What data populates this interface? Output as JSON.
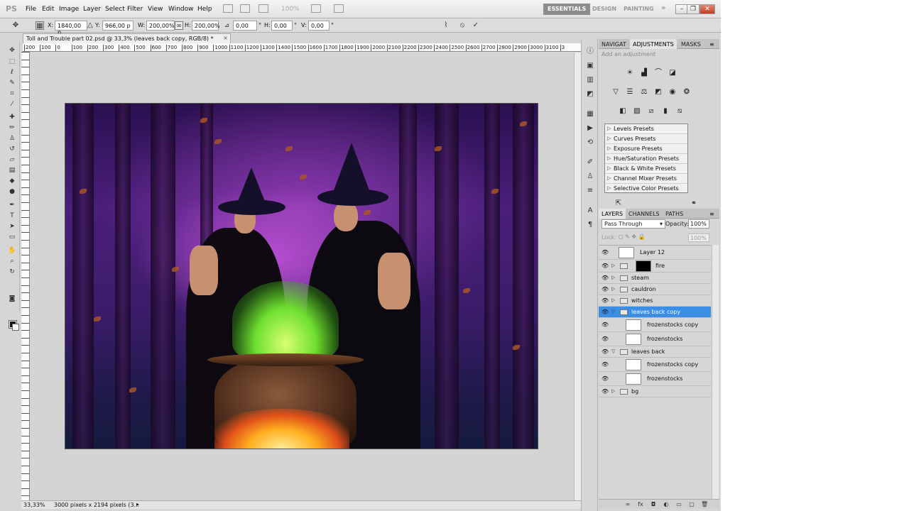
{
  "app": {
    "logo": "PS"
  },
  "menu": [
    "File",
    "Edit",
    "Image",
    "Layer",
    "Select",
    "Filter",
    "View",
    "Window",
    "Help"
  ],
  "zoom_field": "100%",
  "workspaces": {
    "essentials": "ESSENTIALS",
    "design": "DESIGN",
    "painting": "PAINTING",
    "more": "»"
  },
  "window_controls": {
    "minimize": "–",
    "restore": "❐",
    "close": "✕"
  },
  "options": {
    "x_label": "X:",
    "x_value": "1840,00 p",
    "y_label": "Y:",
    "y_value": "966,00 p",
    "w_label": "W:",
    "w_value": "200,00%",
    "h_label": "H:",
    "h_value": "200,00%",
    "angle_label": "⊿",
    "angle_value": "0,00",
    "hskew_label": "H:",
    "hskew_value": "0,00",
    "vskew_label": "V:",
    "vskew_value": "0,00",
    "degree": "°"
  },
  "document": {
    "title": "Toll and Trouble part 02.psd @ 33,3% (leaves back copy, RGB/8) *",
    "close": "×"
  },
  "ruler_h": [
    "200",
    "100",
    "0",
    "100",
    "200",
    "300",
    "400",
    "500",
    "600",
    "700",
    "800",
    "900",
    "1000",
    "1100",
    "1200",
    "1300",
    "1400",
    "1500",
    "1600",
    "1700",
    "1800",
    "1900",
    "2000",
    "2100",
    "2200",
    "2300",
    "2400",
    "2500",
    "2600",
    "2700",
    "2800",
    "2900",
    "3000",
    "3100",
    "3"
  ],
  "status": {
    "zoom": "33,33%",
    "info": "3000 pixels x 2194 pixels (3..."
  },
  "panel_tabs_top": {
    "navigator": "NAVIGAT",
    "adjustments": "ADJUSTMENTS",
    "masks": "MASKS"
  },
  "adjustments_hint": "Add an adjustment",
  "presets": [
    "Levels Presets",
    "Curves Presets",
    "Exposure Presets",
    "Hue/Saturation Presets",
    "Black & White Presets",
    "Channel Mixer Presets",
    "Selective Color Presets"
  ],
  "layer_tabs": {
    "layers": "LAYERS",
    "channels": "CHANNELS",
    "paths": "PATHS"
  },
  "blend_mode": "Pass Through",
  "opacity": {
    "label": "Opacity:",
    "value": "100%"
  },
  "lock": {
    "label": "Lock:",
    "fill": "100%"
  },
  "layers": [
    {
      "name": "Layer 12",
      "kind": "thumb"
    },
    {
      "name": "fire",
      "kind": "folder-mask"
    },
    {
      "name": "steam",
      "kind": "folder"
    },
    {
      "name": "cauldron",
      "kind": "folder"
    },
    {
      "name": "witches",
      "kind": "folder"
    },
    {
      "name": "leaves back copy",
      "kind": "folder-open",
      "selected": true
    },
    {
      "name": "frozenstocks copy",
      "kind": "smart"
    },
    {
      "name": "frozenstocks",
      "kind": "smart"
    },
    {
      "name": "leaves back",
      "kind": "folder-open"
    },
    {
      "name": "frozenstocks copy",
      "kind": "smart"
    },
    {
      "name": "frozenstocks",
      "kind": "smart"
    },
    {
      "name": "bg",
      "kind": "folder"
    }
  ],
  "colors": {
    "selection": "#3a8ee6",
    "essentials_bg": "#8d8d8d",
    "close": "#c23a23"
  }
}
